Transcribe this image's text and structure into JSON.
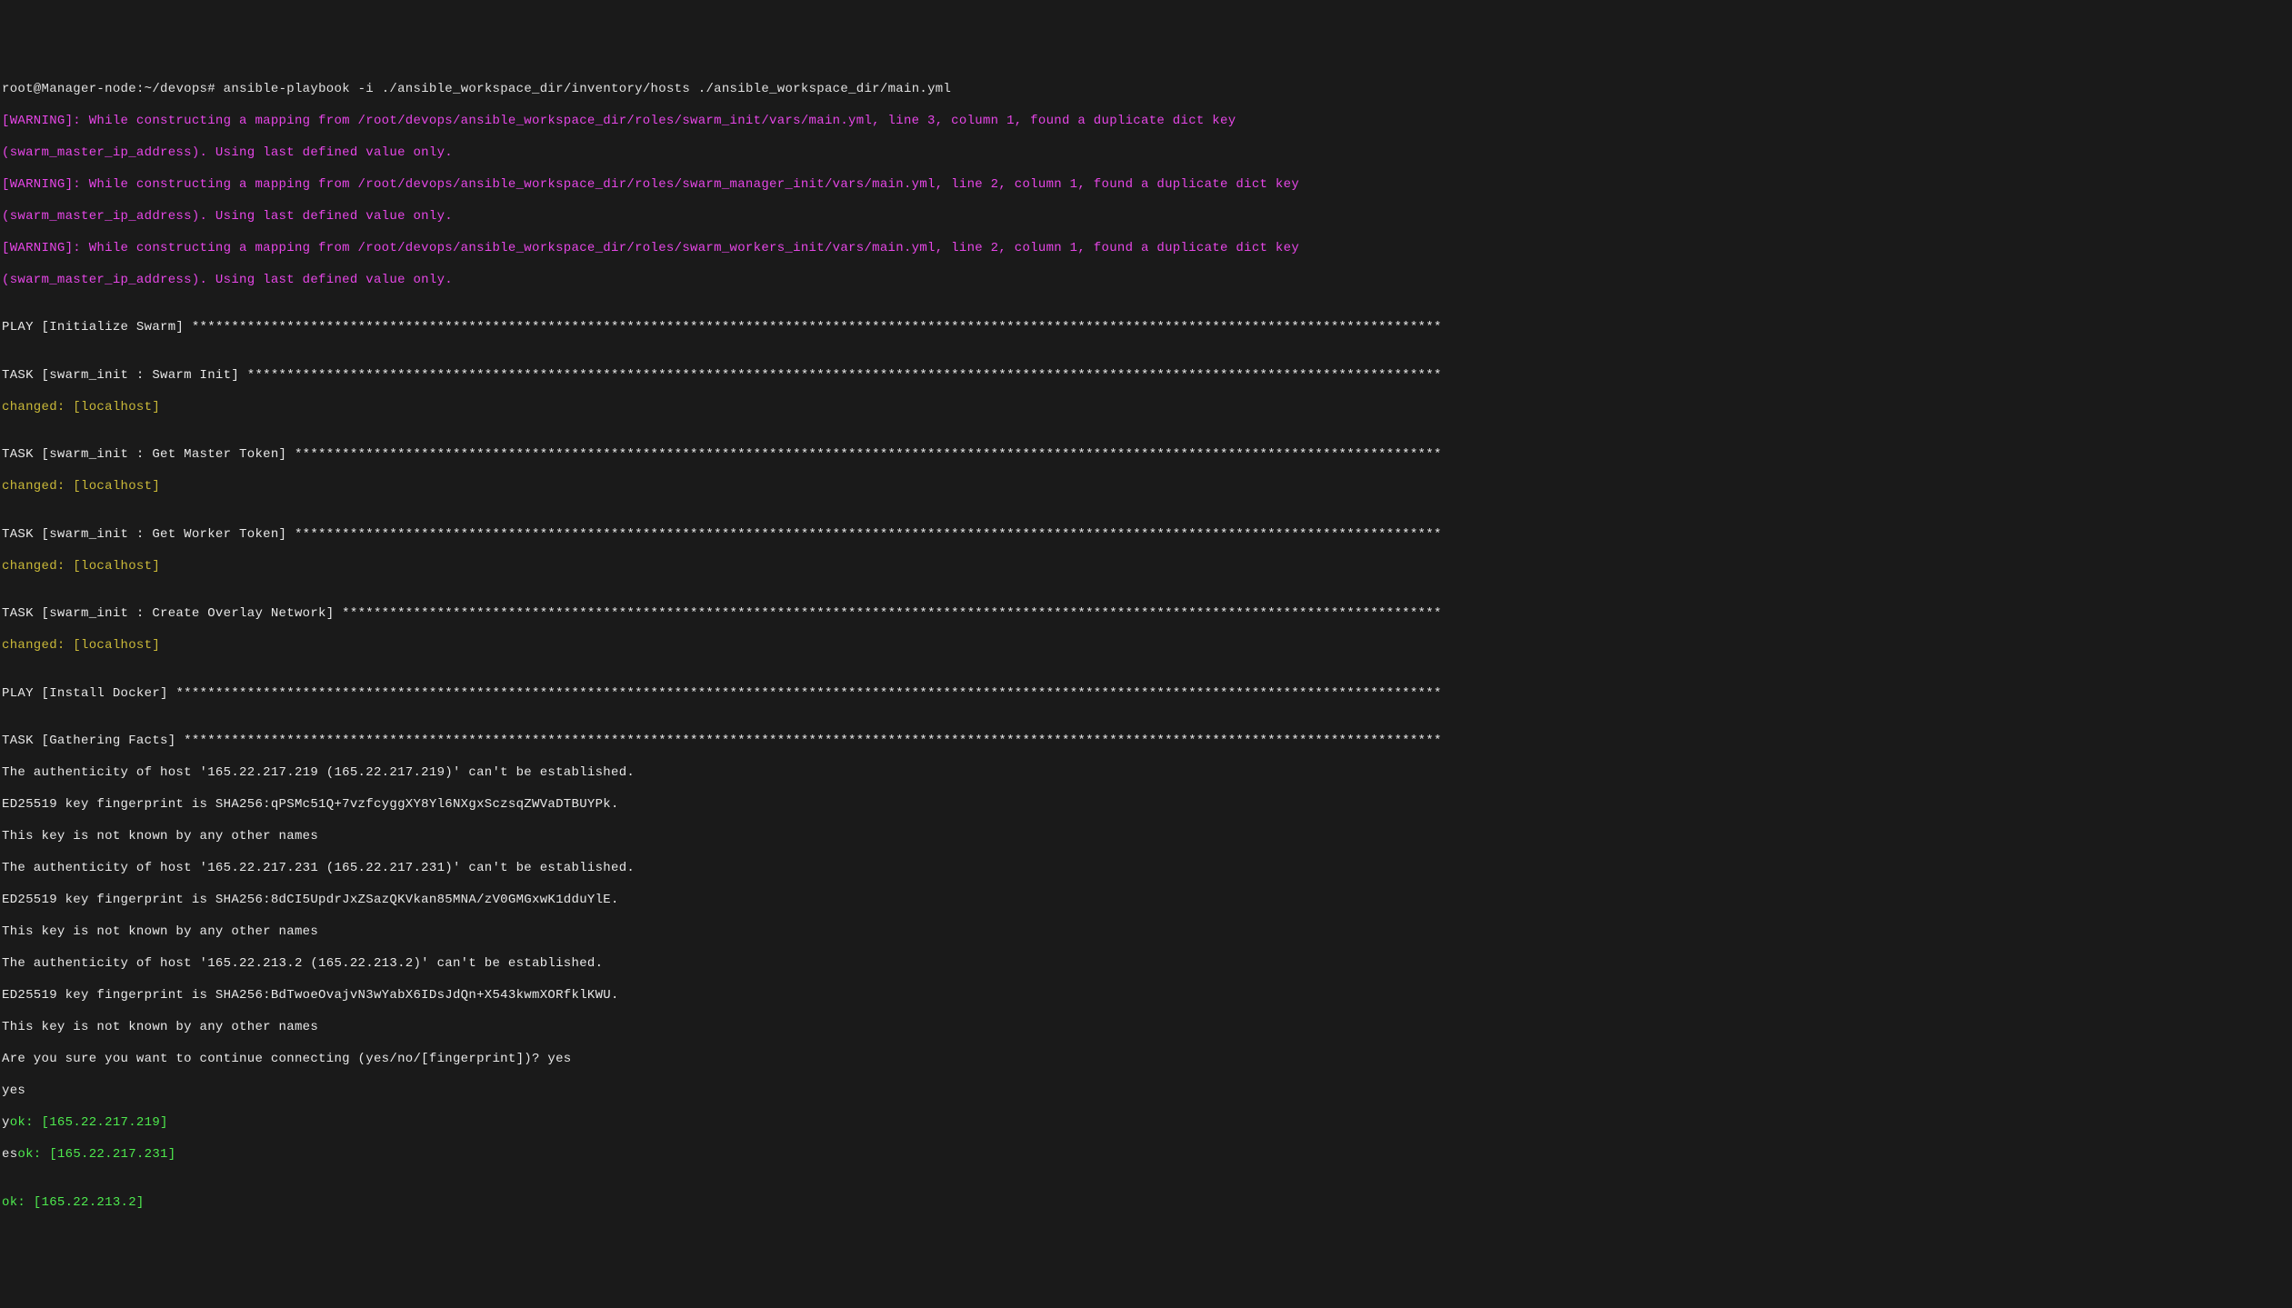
{
  "prompt": {
    "user_host": "root@Manager-node",
    "path": "~/devops",
    "sep": "# ",
    "command": "ansible-playbook -i ./ansible_workspace_dir/inventory/hosts ./ansible_workspace_dir/main.yml"
  },
  "warnings": [
    "[WARNING]: While constructing a mapping from /root/devops/ansible_workspace_dir/roles/swarm_init/vars/main.yml, line 3, column 1, found a duplicate dict key",
    "(swarm_master_ip_address). Using last defined value only.",
    "[WARNING]: While constructing a mapping from /root/devops/ansible_workspace_dir/roles/swarm_manager_init/vars/main.yml, line 2, column 1, found a duplicate dict key",
    "(swarm_master_ip_address). Using last defined value only.",
    "[WARNING]: While constructing a mapping from /root/devops/ansible_workspace_dir/roles/swarm_workers_init/vars/main.yml, line 2, column 1, found a duplicate dict key",
    "(swarm_master_ip_address). Using last defined value only."
  ],
  "blank": "",
  "play1_header": "PLAY [Initialize Swarm] ",
  "task1_header": "TASK [swarm_init : Swarm Init] ",
  "task1_status": "changed: [localhost]",
  "task2_header": "TASK [swarm_init : Get Master Token] ",
  "task2_status": "changed: [localhost]",
  "task3_header": "TASK [swarm_init : Get Worker Token] ",
  "task3_status": "changed: [localhost]",
  "task4_header": "TASK [swarm_init : Create Overlay Network] ",
  "task4_status": "changed: [localhost]",
  "play2_header": "PLAY [Install Docker] ",
  "task5_header": "TASK [Gathering Facts] ",
  "ssh_lines": [
    "The authenticity of host '165.22.217.219 (165.22.217.219)' can't be established.",
    "ED25519 key fingerprint is SHA256:qPSMc51Q+7vzfcyggXY8Yl6NXgxSczsqZWVaDTBUYPk.",
    "This key is not known by any other names",
    "The authenticity of host '165.22.217.231 (165.22.217.231)' can't be established.",
    "ED25519 key fingerprint is SHA256:8dCI5UpdrJxZSazQKVkan85MNA/zV0GMGxwK1dduYlE.",
    "This key is not known by any other names",
    "The authenticity of host '165.22.213.2 (165.22.213.2)' can't be established.",
    "ED25519 key fingerprint is SHA256:BdTwoeOvajvN3wYabX6IDsJdQn+X543kwmXORfklKWU.",
    "This key is not known by any other names",
    "Are you sure you want to continue connecting (yes/no/[fingerprint])? yes",
    "yes"
  ],
  "mixed_line1_prefix": "y",
  "mixed_line1_ok": "ok: [165.22.217.219]",
  "mixed_line2_prefix": "es",
  "mixed_line2_ok": "ok: [165.22.217.231]",
  "final_ok": "ok: [165.22.213.2]"
}
